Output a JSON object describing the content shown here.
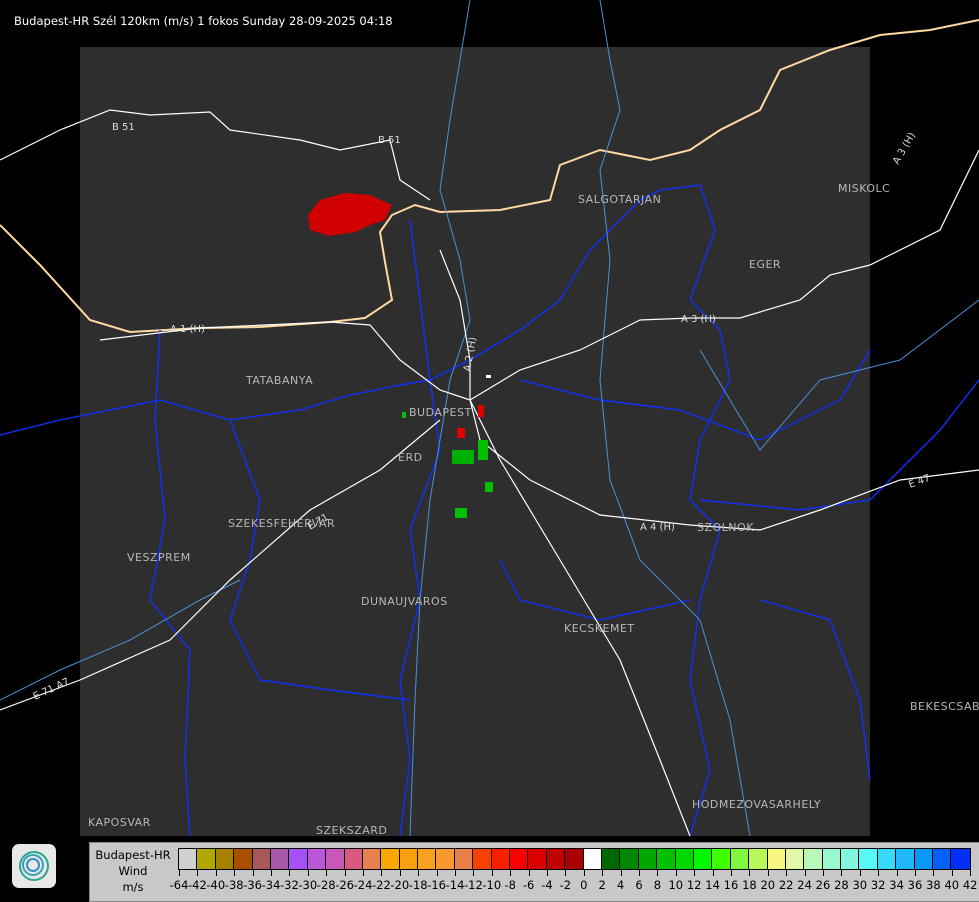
{
  "title": "Budapest-HR Szél 120km (m/s) 1 fokos Sunday 28-09-2025 04:18",
  "map": {
    "panel_color": "#2e2e2e",
    "cities": [
      {
        "name": "SALGOTARJAN"
      },
      {
        "name": "MISKOLC"
      },
      {
        "name": "EGER"
      },
      {
        "name": "TATABANYA"
      },
      {
        "name": "BUDAPEST"
      },
      {
        "name": "ERD"
      },
      {
        "name": "SZEKESFEHERVAR"
      },
      {
        "name": "VESZPREM"
      },
      {
        "name": "DUNAUJVAROS"
      },
      {
        "name": "KECSKEMET"
      },
      {
        "name": "SZOLNOK"
      },
      {
        "name": "BEKESCSABA"
      },
      {
        "name": "HODMEZOVASARHELY"
      },
      {
        "name": "KAPOSVAR"
      },
      {
        "name": "SZEKSZARD"
      }
    ],
    "roads": [
      {
        "name": "B 51"
      },
      {
        "name": "B 51"
      },
      {
        "name": "A 3 (H)"
      },
      {
        "name": "A 3 (H)"
      },
      {
        "name": "A 1 (H)"
      },
      {
        "name": "A 2 (H)"
      },
      {
        "name": "A 4 (H)"
      },
      {
        "name": "E 71"
      },
      {
        "name": "E 71 A7"
      },
      {
        "name": "E 47"
      }
    ]
  },
  "legend": {
    "line1": "Budapest-HR",
    "line2": "Wind",
    "line3": "m/s",
    "labels": [
      "-64",
      "-42",
      "-40",
      "-38",
      "-36",
      "-34",
      "-32",
      "-30",
      "-28",
      "-26",
      "-24",
      "-22",
      "-20",
      "-18",
      "-16",
      "-14",
      "-12",
      "-10",
      "-8",
      "-6",
      "-4",
      "-2",
      "0",
      "2",
      "4",
      "6",
      "8",
      "10",
      "12",
      "14",
      "16",
      "18",
      "20",
      "22",
      "24",
      "26",
      "28",
      "30",
      "32",
      "34",
      "36",
      "38",
      "40",
      "42"
    ],
    "colors": [
      "#d0d0d0",
      "#b0a800",
      "#a88000",
      "#a85000",
      "#a85858",
      "#a858a8",
      "#a850f8",
      "#b858d8",
      "#c858b8",
      "#d85880",
      "#e88050",
      "#f8a800",
      "#f8a010",
      "#f8a020",
      "#f89830",
      "#e88048",
      "#f84000",
      "#f82000",
      "#f80000",
      "#d80000",
      "#c00000",
      "#a80000",
      "#ffffff",
      "#006800",
      "#008800",
      "#00a800",
      "#00c000",
      "#00d800",
      "#00f800",
      "#40ff00",
      "#80f840",
      "#b8f858",
      "#f8f880",
      "#e0f8a8",
      "#b8f8b8",
      "#98f8d0",
      "#80f8e0",
      "#58f8f8",
      "#38d8f8",
      "#20b8f8",
      "#0898f8",
      "#0060f8",
      "#0030f8",
      "#0000f0"
    ]
  }
}
